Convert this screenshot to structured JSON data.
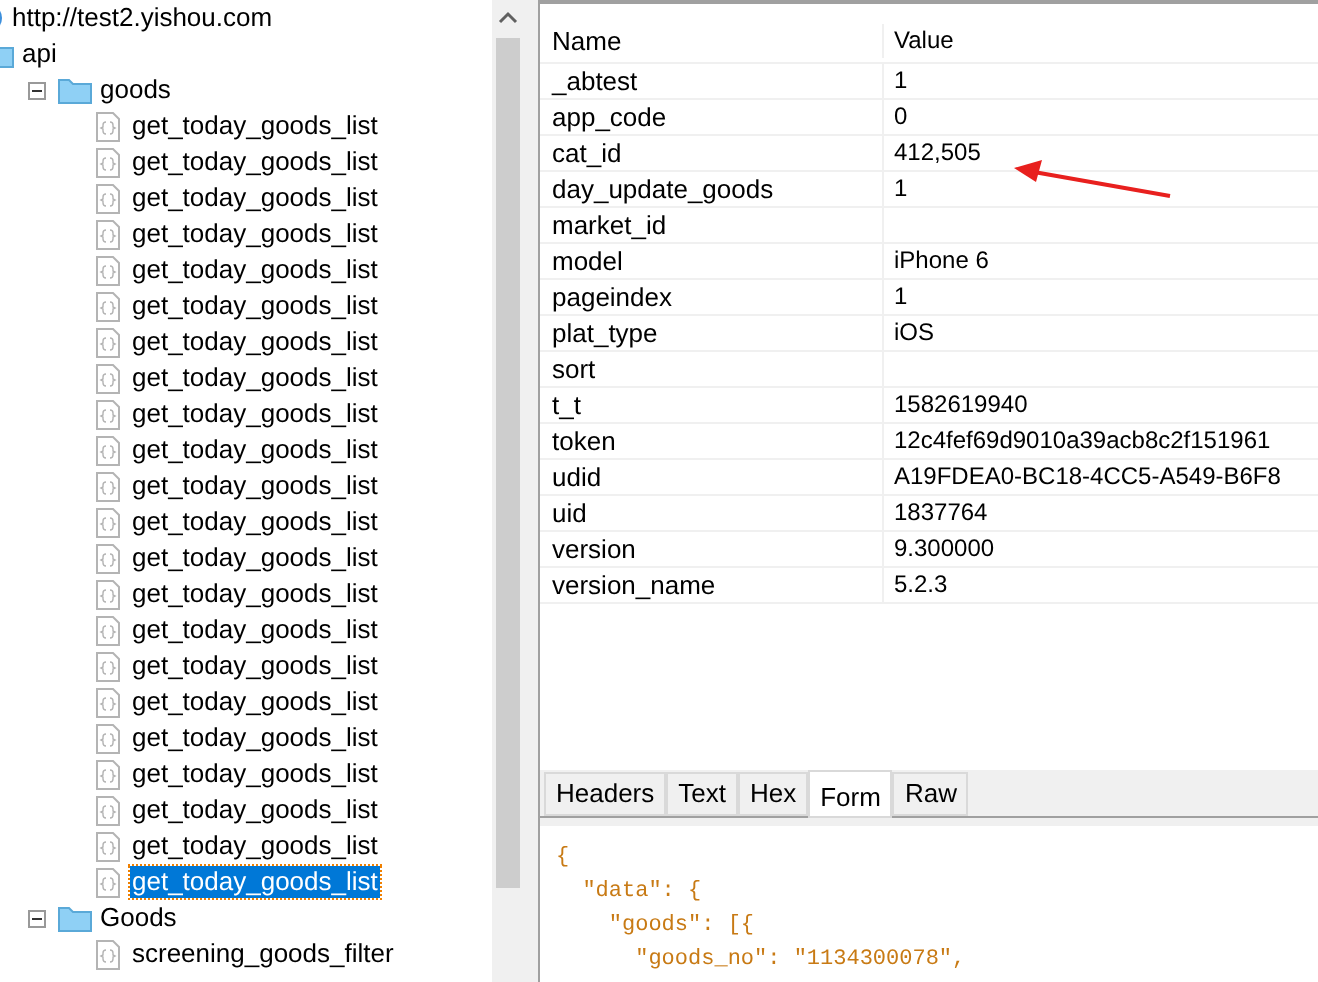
{
  "tree": {
    "label": "http://test2.yishou.com",
    "children": [
      {
        "label": "api",
        "expanded": true,
        "children": [
          {
            "label": "goods",
            "expanded": true,
            "children": [
              {
                "label": "get_today_goods_list",
                "selected": false
              },
              {
                "label": "get_today_goods_list",
                "selected": false
              },
              {
                "label": "get_today_goods_list",
                "selected": false
              },
              {
                "label": "get_today_goods_list",
                "selected": false
              },
              {
                "label": "get_today_goods_list",
                "selected": false
              },
              {
                "label": "get_today_goods_list",
                "selected": false
              },
              {
                "label": "get_today_goods_list",
                "selected": false
              },
              {
                "label": "get_today_goods_list",
                "selected": false
              },
              {
                "label": "get_today_goods_list",
                "selected": false
              },
              {
                "label": "get_today_goods_list",
                "selected": false
              },
              {
                "label": "get_today_goods_list",
                "selected": false
              },
              {
                "label": "get_today_goods_list",
                "selected": false
              },
              {
                "label": "get_today_goods_list",
                "selected": false
              },
              {
                "label": "get_today_goods_list",
                "selected": false
              },
              {
                "label": "get_today_goods_list",
                "selected": false
              },
              {
                "label": "get_today_goods_list",
                "selected": false
              },
              {
                "label": "get_today_goods_list",
                "selected": false
              },
              {
                "label": "get_today_goods_list",
                "selected": false
              },
              {
                "label": "get_today_goods_list",
                "selected": false
              },
              {
                "label": "get_today_goods_list",
                "selected": false
              },
              {
                "label": "get_today_goods_list",
                "selected": false
              },
              {
                "label": "get_today_goods_list",
                "selected": true
              }
            ]
          },
          {
            "label": "Goods",
            "expanded": true,
            "children": [
              {
                "label": "screening_goods_filter",
                "selected": false
              }
            ]
          }
        ]
      }
    ]
  },
  "params": {
    "columns": [
      "Name",
      "Value"
    ],
    "rows": [
      [
        "_abtest",
        "1"
      ],
      [
        "app_code",
        "0"
      ],
      [
        "cat_id",
        "412,505"
      ],
      [
        "day_update_goods",
        "1"
      ],
      [
        "market_id",
        ""
      ],
      [
        "model",
        "iPhone 6"
      ],
      [
        "pageindex",
        "1"
      ],
      [
        "plat_type",
        "iOS"
      ],
      [
        "sort",
        ""
      ],
      [
        "t_t",
        "1582619940"
      ],
      [
        "token",
        "12c4fef69d9010a39acb8c2f151961"
      ],
      [
        "udid",
        "A19FDEA0-BC18-4CC5-A549-B6F8"
      ],
      [
        "uid",
        "1837764"
      ],
      [
        "version",
        "9.300000"
      ],
      [
        "version_name",
        "5.2.3"
      ]
    ]
  },
  "tabs": [
    {
      "label": "Headers",
      "selected": false
    },
    {
      "label": "Text",
      "selected": false
    },
    {
      "label": "Hex",
      "selected": false
    },
    {
      "label": "Form",
      "selected": true
    },
    {
      "label": "Raw",
      "selected": false
    }
  ],
  "body_lines": [
    "{",
    "  \"data\": {",
    "    \"goods\": [{",
    "      \"goods_no\": \"1134300078\","
  ]
}
